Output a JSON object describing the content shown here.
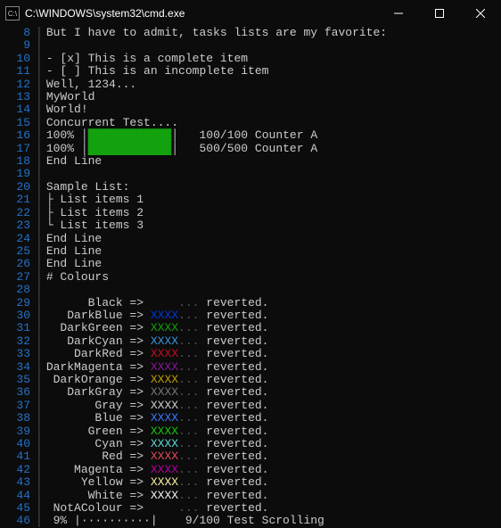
{
  "window": {
    "title": "C:\\WINDOWS\\system32\\cmd.exe"
  },
  "lines": {
    "l8": "But I have to admit, tasks lists are my favorite:",
    "l9": "",
    "l10": "- [x] This is a complete item",
    "l11": "- [ ] This is an incomplete item",
    "l12": "Well, 1234...",
    "l13": "MyWorld",
    "l14": "World!",
    "l15": "Concurrent Test....",
    "l16": {
      "pct": "100%",
      "counter": "100/100 Counter A"
    },
    "l17": {
      "pct": "100%",
      "counter": "500/500 Counter A"
    },
    "l18": "End Line",
    "l19": "",
    "l20": "Sample List:",
    "l21": "├ List items 1",
    "l22": "├ List items 2",
    "l23": "└ List items 3",
    "l24": "End Line",
    "l25": "End Line",
    "l26": "End Line",
    "l27": "# Colours",
    "l28": ""
  },
  "colours": [
    {
      "name": "Black",
      "class": "c-Black"
    },
    {
      "name": "DarkBlue",
      "class": "c-DarkBlue"
    },
    {
      "name": "DarkGreen",
      "class": "c-DarkGreen"
    },
    {
      "name": "DarkCyan",
      "class": "c-DarkCyan"
    },
    {
      "name": "DarkRed",
      "class": "c-DarkRed"
    },
    {
      "name": "DarkMagenta",
      "class": "c-DarkMagenta"
    },
    {
      "name": "DarkOrange",
      "class": "c-DarkOrange"
    },
    {
      "name": "DarkGray",
      "class": "c-DarkGray"
    },
    {
      "name": "Gray",
      "class": "c-Gray"
    },
    {
      "name": "Blue",
      "class": "c-Blue"
    },
    {
      "name": "Green",
      "class": "c-Green"
    },
    {
      "name": "Cyan",
      "class": "c-Cyan"
    },
    {
      "name": "Red",
      "class": "c-Red"
    },
    {
      "name": "Magenta",
      "class": "c-Magenta"
    },
    {
      "name": "Yellow",
      "class": "c-Yellow"
    },
    {
      "name": "White",
      "class": "c-White"
    },
    {
      "name": "NotAColour",
      "class": "c-NotAColour"
    }
  ],
  "colour_sample": "XXXX",
  "colour_dots": "...",
  "colour_reverted": "reverted.",
  "scroll": {
    "pct": "9%",
    "bar": "|··········|",
    "counter": "9/100 Test Scrolling"
  },
  "lineno": {
    "start": 8,
    "colour_start": 29,
    "scroll": 46
  }
}
